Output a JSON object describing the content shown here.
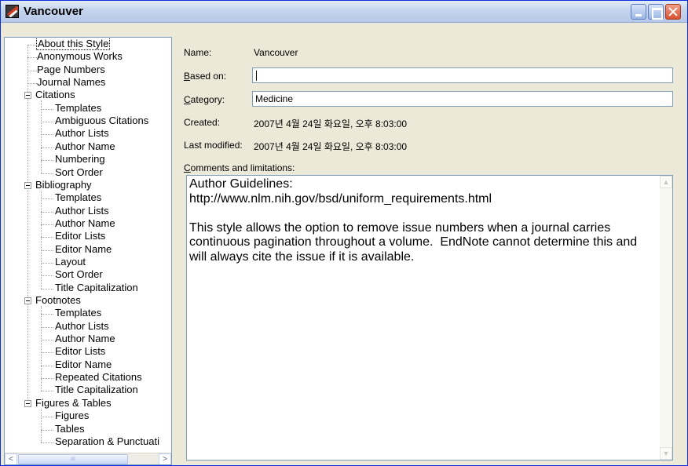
{
  "window": {
    "title": "Vancouver"
  },
  "tree": {
    "items": [
      {
        "label": "About this Style",
        "level": 1,
        "selected": true
      },
      {
        "label": "Anonymous Works",
        "level": 1
      },
      {
        "label": "Page Numbers",
        "level": 1
      },
      {
        "label": "Journal Names",
        "level": 1
      },
      {
        "label": "Citations",
        "level": 0,
        "expanded": true
      },
      {
        "label": "Templates",
        "level": 2
      },
      {
        "label": "Ambiguous Citations",
        "level": 2
      },
      {
        "label": "Author Lists",
        "level": 2
      },
      {
        "label": "Author Name",
        "level": 2
      },
      {
        "label": "Numbering",
        "level": 2
      },
      {
        "label": "Sort Order",
        "level": 2
      },
      {
        "label": "Bibliography",
        "level": 0,
        "expanded": true
      },
      {
        "label": "Templates",
        "level": 2
      },
      {
        "label": "Author Lists",
        "level": 2
      },
      {
        "label": "Author Name",
        "level": 2
      },
      {
        "label": "Editor Lists",
        "level": 2
      },
      {
        "label": "Editor Name",
        "level": 2
      },
      {
        "label": "Layout",
        "level": 2
      },
      {
        "label": "Sort Order",
        "level": 2
      },
      {
        "label": "Title Capitalization",
        "level": 2
      },
      {
        "label": "Footnotes",
        "level": 0,
        "expanded": true
      },
      {
        "label": "Templates",
        "level": 2
      },
      {
        "label": "Author Lists",
        "level": 2
      },
      {
        "label": "Author Name",
        "level": 2
      },
      {
        "label": "Editor Lists",
        "level": 2
      },
      {
        "label": "Editor Name",
        "level": 2
      },
      {
        "label": "Repeated Citations",
        "level": 2
      },
      {
        "label": "Title Capitalization",
        "level": 2
      },
      {
        "label": "Figures & Tables",
        "level": 0,
        "expanded": true
      },
      {
        "label": "Figures",
        "level": 2
      },
      {
        "label": "Tables",
        "level": 2
      },
      {
        "label": "Separation & Punctuati",
        "level": 2
      }
    ],
    "scroll_left_glyph": "<",
    "scroll_right_glyph": ">",
    "scroll_grip_glyph": "III"
  },
  "details": {
    "name_label": "Name:",
    "name_value": "Vancouver",
    "based_on_label_key": "B",
    "based_on_label_rest": "ased on:",
    "based_on_value": "",
    "category_label_key": "C",
    "category_label_rest": "ategory:",
    "category_value": "Medicine",
    "created_label": "Created:",
    "created_value": "2007년 4월 24일 화요일, 오후 8:03:00",
    "modified_label": "Last modified:",
    "modified_value": "2007년 4월 24일 화요일, 오후 8:03:00",
    "comments_label_key": "C",
    "comments_label_rest": "omments and limitations:",
    "comments_text": "Author Guidelines:\nhttp://www.nlm.nih.gov/bsd/uniform_requirements.html\n\nThis style allows the option to remove issue numbers when a journal carries continuous pagination throughout a volume.  EndNote cannot determine this and will always cite the issue if it is available."
  },
  "colors": {
    "title_gradient_top": "#e4ecf8",
    "close_button": "#d7512f",
    "field_border": "#7f9db9"
  }
}
